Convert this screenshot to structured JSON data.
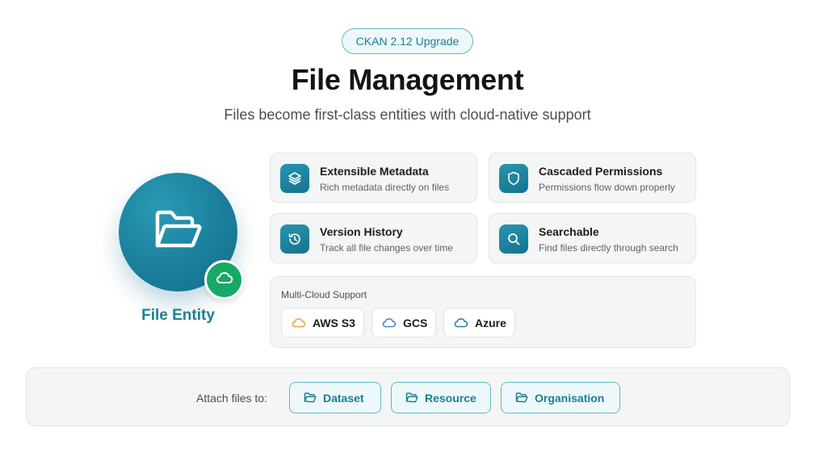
{
  "header": {
    "badge": "CKAN 2.12 Upgrade",
    "title": "File Management",
    "subtitle": "Files become first-class entities with cloud-native support"
  },
  "entity": {
    "label": "File Entity",
    "icon": "folder-open-icon",
    "badge_icon": "cloud-icon"
  },
  "features": [
    {
      "title": "Extensible Metadata",
      "desc": "Rich metadata directly on files",
      "icon": "layers-icon"
    },
    {
      "title": "Cascaded Permissions",
      "desc": "Permissions flow down properly",
      "icon": "shield-icon"
    },
    {
      "title": "Version History",
      "desc": "Track all file changes over time",
      "icon": "history-icon"
    },
    {
      "title": "Searchable",
      "desc": "Find files directly through search",
      "icon": "search-icon"
    }
  ],
  "multi_cloud": {
    "title": "Multi-Cloud Support",
    "providers": [
      {
        "label": "AWS S3",
        "icon": "cloud-icon",
        "color": "#e8a73a"
      },
      {
        "label": "GCS",
        "icon": "cloud-icon",
        "color": "#4a86d9"
      },
      {
        "label": "Azure",
        "icon": "cloud-icon",
        "color": "#2f7fb0"
      }
    ]
  },
  "attach": {
    "label": "Attach files to:",
    "targets": [
      {
        "label": "Dataset",
        "icon": "folder-icon"
      },
      {
        "label": "Resource",
        "icon": "folder-icon"
      },
      {
        "label": "Organisation",
        "icon": "folder-icon"
      }
    ]
  },
  "colors": {
    "accent": "#1b7f94",
    "accent_light": "#eef8fa",
    "green": "#17a866"
  }
}
